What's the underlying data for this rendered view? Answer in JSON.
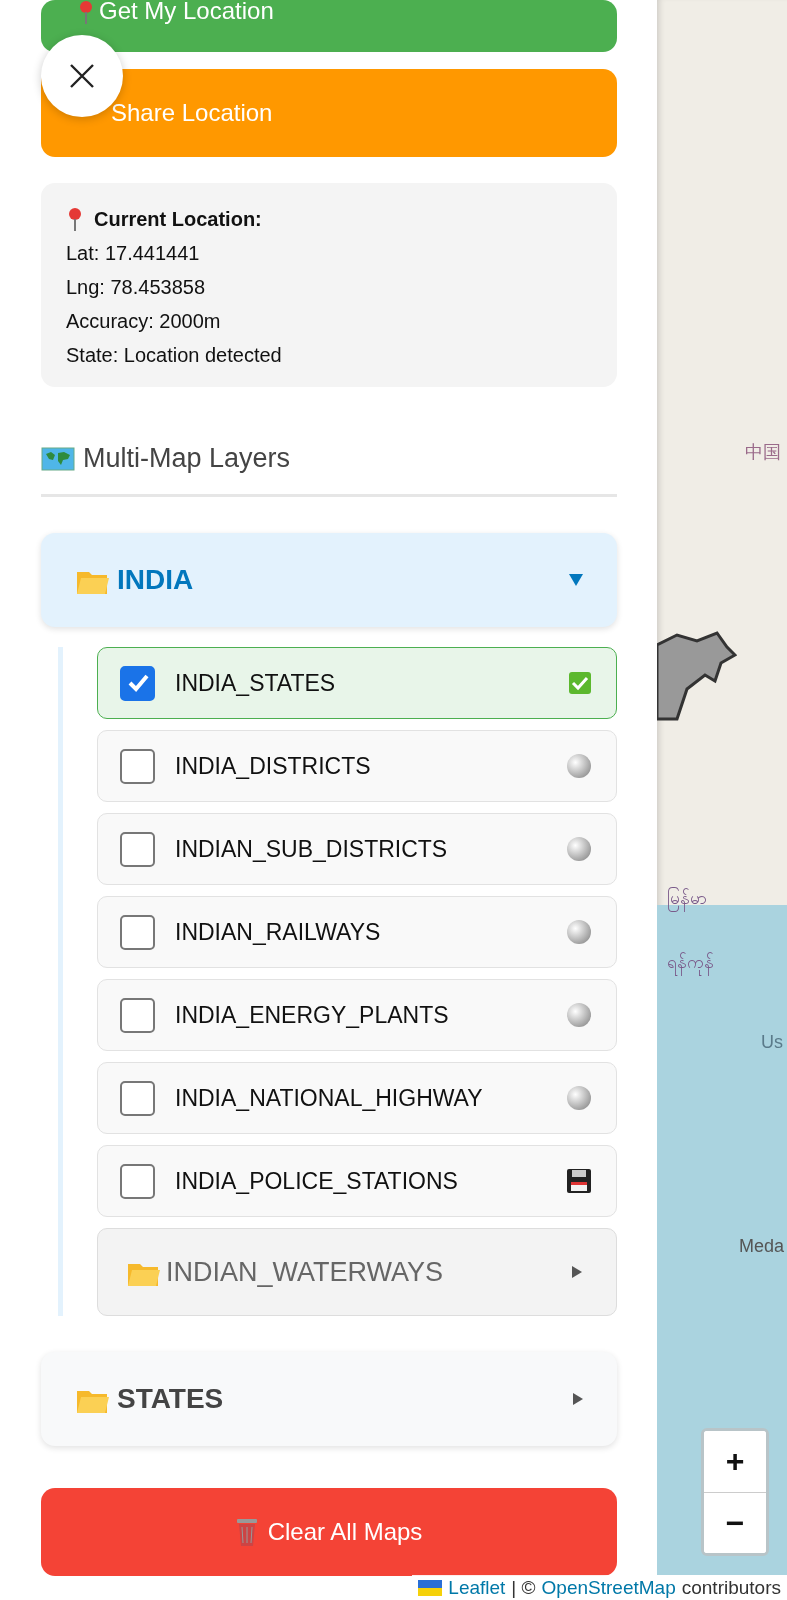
{
  "panel": {
    "buttons": [
      {
        "kind": "locate",
        "label": "Get My Location"
      },
      {
        "kind": "share",
        "label": "Share Location"
      }
    ],
    "location": {
      "title": "Current Location:",
      "lines": [
        "Lat: 17.441441",
        "Lng: 78.453858",
        "Accuracy: 2000m",
        "State: Location detected"
      ]
    },
    "layers": {
      "title": "Multi-Map Layers",
      "groups": [
        {
          "name": "INDIA",
          "expanded": true,
          "children": [
            {
              "kind": "layer",
              "name": "INDIA_STATES",
              "checked": true,
              "loaded": true
            },
            {
              "kind": "layer",
              "name": "INDIA_DISTRICTS",
              "checked": false,
              "loaded": false,
              "cached": false
            },
            {
              "kind": "layer",
              "name": "INDIAN_SUB_DISTRICTS",
              "checked": false,
              "loaded": false,
              "cached": false
            },
            {
              "kind": "layer",
              "name": "INDIAN_RAILWAYS",
              "checked": false,
              "loaded": false,
              "cached": false
            },
            {
              "kind": "layer",
              "name": "INDIA_ENERGY_PLANTS",
              "checked": false,
              "loaded": false,
              "cached": false
            },
            {
              "kind": "layer",
              "name": "INDIA_NATIONAL_HIGHWAY",
              "checked": false,
              "loaded": false,
              "cached": false
            },
            {
              "kind": "layer",
              "name": "INDIA_POLICE_STATIONS",
              "checked": false,
              "loaded": false,
              "cached": true
            },
            {
              "kind": "folder",
              "name": "INDIAN_WATERWAYS",
              "expanded": false
            }
          ]
        },
        {
          "name": "STATES",
          "expanded": false
        }
      ]
    },
    "clear_button": "Clear All Maps"
  },
  "map": {
    "labels": [
      "中国",
      "မြန်မာ",
      "ရန်ကုန်",
      "Us",
      "Meda"
    ],
    "zoom": [
      "+",
      "−"
    ],
    "attribution": {
      "links": [
        "Leaflet",
        "OpenStreetMap"
      ],
      "separator": "| ©",
      "suffix": "contributors"
    }
  }
}
